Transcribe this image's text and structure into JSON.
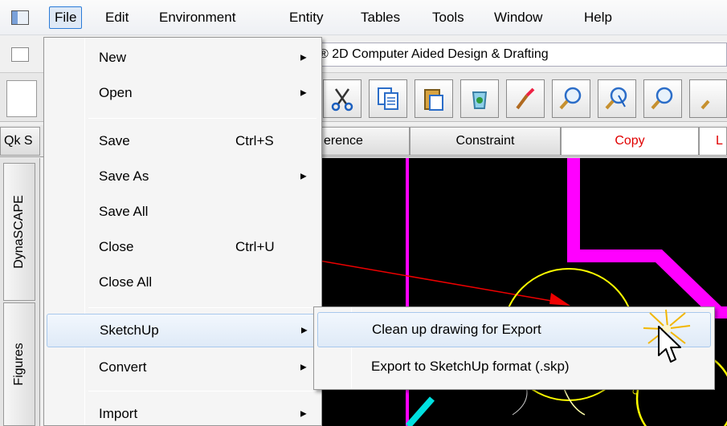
{
  "menubar": {
    "items": [
      "File",
      "Edit",
      "Environment",
      "Entity",
      "Tables",
      "Tools",
      "Window",
      "Help"
    ]
  },
  "titlebar": {
    "text": "® 2D Computer Aided Design & Drafting"
  },
  "tabs": {
    "qk": "Qk S",
    "reference": "erence",
    "constraint": "Constraint",
    "copy": "Copy",
    "l": "L"
  },
  "side_tabs": {
    "dynascape": "DynaSCAPE",
    "figures": "Figures"
  },
  "file_menu": {
    "new": "New",
    "open": "Open",
    "save": "Save",
    "save_shortcut": "Ctrl+S",
    "save_as": "Save As",
    "save_all": "Save All",
    "close": "Close",
    "close_shortcut": "Ctrl+U",
    "close_all": "Close All",
    "sketchup": "SketchUp",
    "convert": "Convert",
    "import": "Import"
  },
  "sketchup_submenu": {
    "clean_up": "Clean up drawing for Export",
    "export": "Export to SketchUp format (.skp)"
  },
  "colors": {
    "menu_highlight": "#dfeaf7",
    "canvas": "#000000",
    "magenta": "#ff00ff",
    "yellow": "#ffff00",
    "copy_tab_text": "#e00000"
  }
}
